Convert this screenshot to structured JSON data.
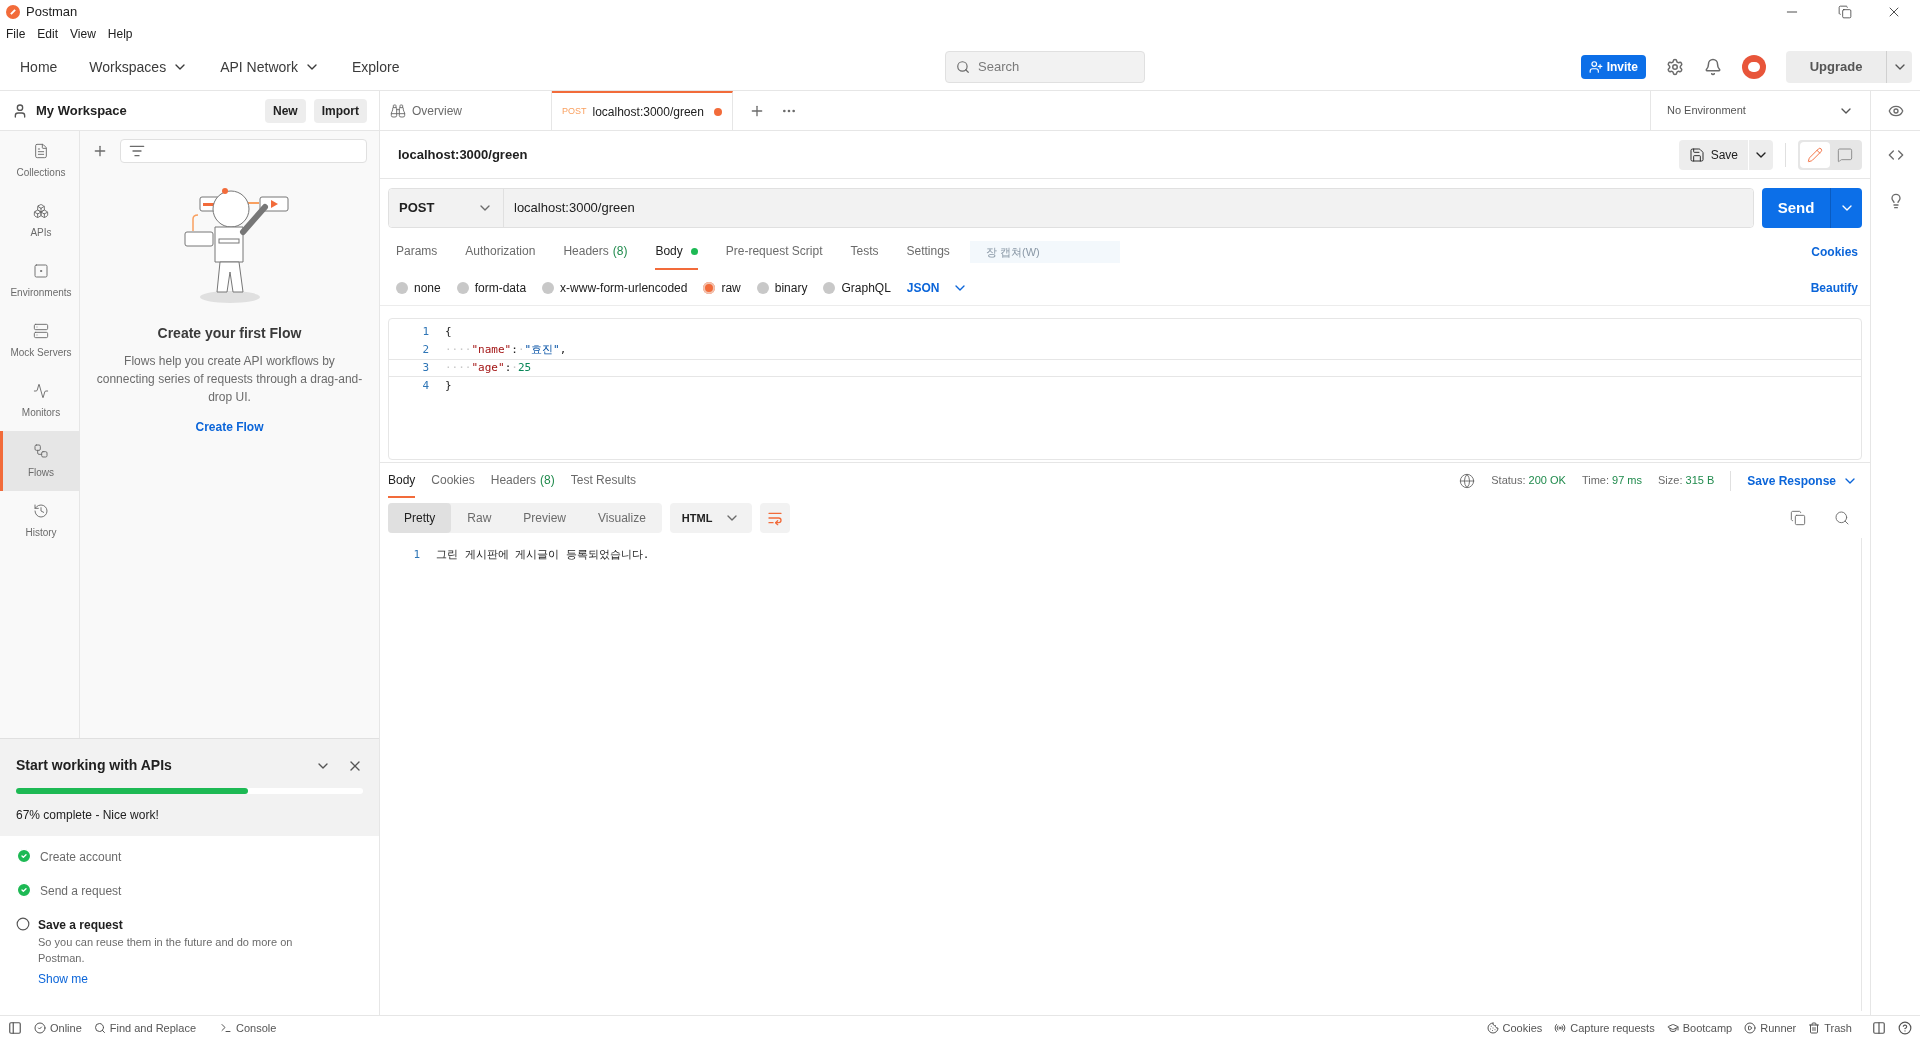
{
  "window": {
    "title": "Postman"
  },
  "menu": [
    "File",
    "Edit",
    "View",
    "Help"
  ],
  "nav": [
    {
      "label": "Home",
      "dropdown": false
    },
    {
      "label": "Workspaces",
      "dropdown": true
    },
    {
      "label": "API Network",
      "dropdown": true
    },
    {
      "label": "Explore",
      "dropdown": false
    }
  ],
  "search": {
    "placeholder": "Search"
  },
  "header_actions": {
    "invite": "Invite",
    "upgrade": "Upgrade"
  },
  "workspace": {
    "name": "My Workspace",
    "buttons": [
      "New",
      "Import"
    ]
  },
  "rail": [
    {
      "kind": "collections",
      "label": "Collections",
      "selected": false
    },
    {
      "kind": "apis",
      "label": "APIs",
      "selected": false
    },
    {
      "kind": "environments",
      "label": "Environments",
      "selected": false
    },
    {
      "kind": "mock",
      "label": "Mock Servers",
      "selected": false
    },
    {
      "kind": "monitors",
      "label": "Monitors",
      "selected": false
    },
    {
      "kind": "flows",
      "label": "Flows",
      "selected": true
    },
    {
      "kind": "history",
      "label": "History",
      "selected": false
    }
  ],
  "flows_empty": {
    "title": "Create your first Flow",
    "text": "Flows help you create API workflows by connecting series of requests through a drag-and-drop UI.",
    "link": "Create Flow"
  },
  "onboarding": {
    "title": "Start working with APIs",
    "level": 0.67,
    "progress": "67% complete - Nice work!",
    "tasks": [
      {
        "label": "Create account",
        "checked": true
      },
      {
        "label": "Send a request",
        "checked": true
      },
      {
        "label": "Save a request",
        "checked": false,
        "description": "So you can reuse them in the future and do more on Postman.",
        "link": "Show me"
      }
    ]
  },
  "tabs": [
    {
      "kind": "overview",
      "label": "Overview",
      "selected": false
    },
    {
      "kind": "request",
      "method": "POST",
      "label": "localhost:3000/green",
      "selected": true,
      "unsaved": true
    }
  ],
  "environment": "No Environment",
  "request": {
    "name": "localhost:3000/green",
    "save": "Save",
    "modes": [
      {
        "kind": "edit",
        "selected": true
      },
      {
        "kind": "comment",
        "selected": false
      }
    ],
    "method": "POST",
    "url": "localhost:3000/green",
    "send": "Send",
    "tabs": [
      {
        "label": "Params",
        "selected": false
      },
      {
        "label": "Authorization",
        "selected": false
      },
      {
        "label": "Headers",
        "count": "(8)",
        "selected": false
      },
      {
        "label": "Body",
        "selected": true,
        "has_content": true
      },
      {
        "label": "Pre-request Script",
        "selected": false
      },
      {
        "label": "Tests",
        "selected": false
      },
      {
        "label": "Settings",
        "selected": false
      }
    ],
    "ghost_tooltip": "장 캡쳐(W)",
    "cookies": "Cookies",
    "body_types": [
      {
        "label": "none",
        "selected": false
      },
      {
        "label": "form-data",
        "selected": false
      },
      {
        "label": "x-www-form-urlencoded",
        "selected": false
      },
      {
        "label": "raw",
        "selected": true
      },
      {
        "label": "binary",
        "selected": false
      },
      {
        "label": "GraphQL",
        "selected": false
      }
    ],
    "format": "JSON",
    "beautify": "Beautify",
    "lines": [
      {
        "number": "1",
        "current": false,
        "tokens": [
          {
            "kind": "punct",
            "text": "{"
          }
        ]
      },
      {
        "number": "2",
        "current": false,
        "tokens": [
          {
            "kind": "space",
            "text": "····"
          },
          {
            "kind": "key",
            "text": "\"name\""
          },
          {
            "kind": "punct",
            "text": ":"
          },
          {
            "kind": "space",
            "text": "·"
          },
          {
            "kind": "string",
            "text": "\"효진\""
          },
          {
            "kind": "punct",
            "text": ","
          }
        ]
      },
      {
        "number": "3",
        "current": true,
        "tokens": [
          {
            "kind": "space",
            "text": "····"
          },
          {
            "kind": "key",
            "text": "\"age\""
          },
          {
            "kind": "punct",
            "text": ":"
          },
          {
            "kind": "space",
            "text": "·"
          },
          {
            "kind": "number",
            "text": "25"
          }
        ]
      },
      {
        "number": "4",
        "current": false,
        "tokens": [
          {
            "kind": "punct",
            "text": "}"
          }
        ]
      }
    ]
  },
  "response": {
    "tabs": [
      {
        "label": "Body",
        "selected": true
      },
      {
        "label": "Cookies",
        "selected": false
      },
      {
        "label": "Headers",
        "count": "(8)",
        "selected": false
      },
      {
        "label": "Test Results",
        "selected": false
      }
    ],
    "stats": [
      {
        "label": "Status:",
        "value": "200 OK"
      },
      {
        "label": "Time:",
        "value": "97 ms"
      },
      {
        "label": "Size:",
        "value": "315 B"
      }
    ],
    "save": "Save Response",
    "views": [
      {
        "label": "Pretty",
        "selected": true
      },
      {
        "label": "Raw",
        "selected": false
      },
      {
        "label": "Preview",
        "selected": false
      },
      {
        "label": "Visualize",
        "selected": false
      }
    ],
    "format": "HTML",
    "lines": [
      {
        "number": "1",
        "text": "그린 게시판에 게시글이 등록되었습니다."
      }
    ]
  },
  "status_bar": {
    "left": [
      {
        "kind": "online",
        "label": "Online"
      },
      {
        "kind": "find",
        "label": "Find and Replace"
      },
      {
        "kind": "console",
        "label": "Console"
      }
    ],
    "right": [
      {
        "kind": "cookies",
        "label": "Cookies"
      },
      {
        "kind": "capture",
        "label": "Capture requests"
      },
      {
        "kind": "bootcamp",
        "label": "Bootcamp"
      },
      {
        "kind": "runner",
        "label": "Runner"
      },
      {
        "kind": "trash",
        "label": "Trash"
      }
    ]
  }
}
